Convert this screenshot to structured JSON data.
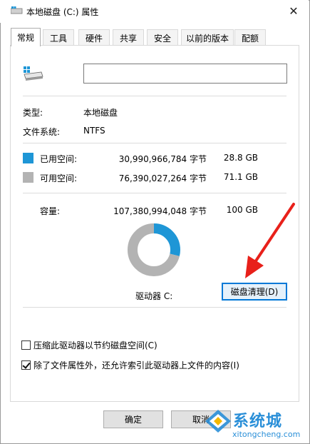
{
  "window": {
    "title": "本地磁盘 (C:) 属性",
    "close_glyph": "✕"
  },
  "tabs": [
    {
      "label": "常规",
      "active": true
    },
    {
      "label": "工具",
      "active": false
    },
    {
      "label": "硬件",
      "active": false
    },
    {
      "label": "共享",
      "active": false
    },
    {
      "label": "安全",
      "active": false
    },
    {
      "label": "以前的版本",
      "active": false
    },
    {
      "label": "配额",
      "active": false
    }
  ],
  "general": {
    "drive_name_value": "",
    "type_label": "类型:",
    "type_value": "本地磁盘",
    "fs_label": "文件系统:",
    "fs_value": "NTFS",
    "used": {
      "label": "已用空间:",
      "bytes": "30,990,966,784 字节",
      "size": "28.8 GB",
      "color": "#1e96d6"
    },
    "free": {
      "label": "可用空间:",
      "bytes": "76,390,027,264 字节",
      "size": "71.1 GB",
      "color": "#b3b3b3"
    },
    "capacity": {
      "label": "容量:",
      "bytes": "107,380,994,048 字节",
      "size": "100 GB"
    },
    "drive_label": "驱动器 C:",
    "cleanup_button": "磁盘清理(D)"
  },
  "options": {
    "compress_label": "压缩此驱动器以节约磁盘空间(C)",
    "compress_checked": false,
    "index_label": "除了文件属性外，还允许索引此驱动器上文件的内容(I)",
    "index_checked": true
  },
  "buttons": {
    "ok": "确定",
    "cancel": "取消"
  },
  "watermark": {
    "brand": "系统城",
    "url": "xitongcheng.com"
  },
  "chart_data": {
    "type": "pie",
    "categories": [
      "已用空间",
      "可用空间"
    ],
    "values": [
      28.8,
      71.1
    ],
    "colors": [
      "#1e96d6",
      "#b3b3b3"
    ]
  }
}
